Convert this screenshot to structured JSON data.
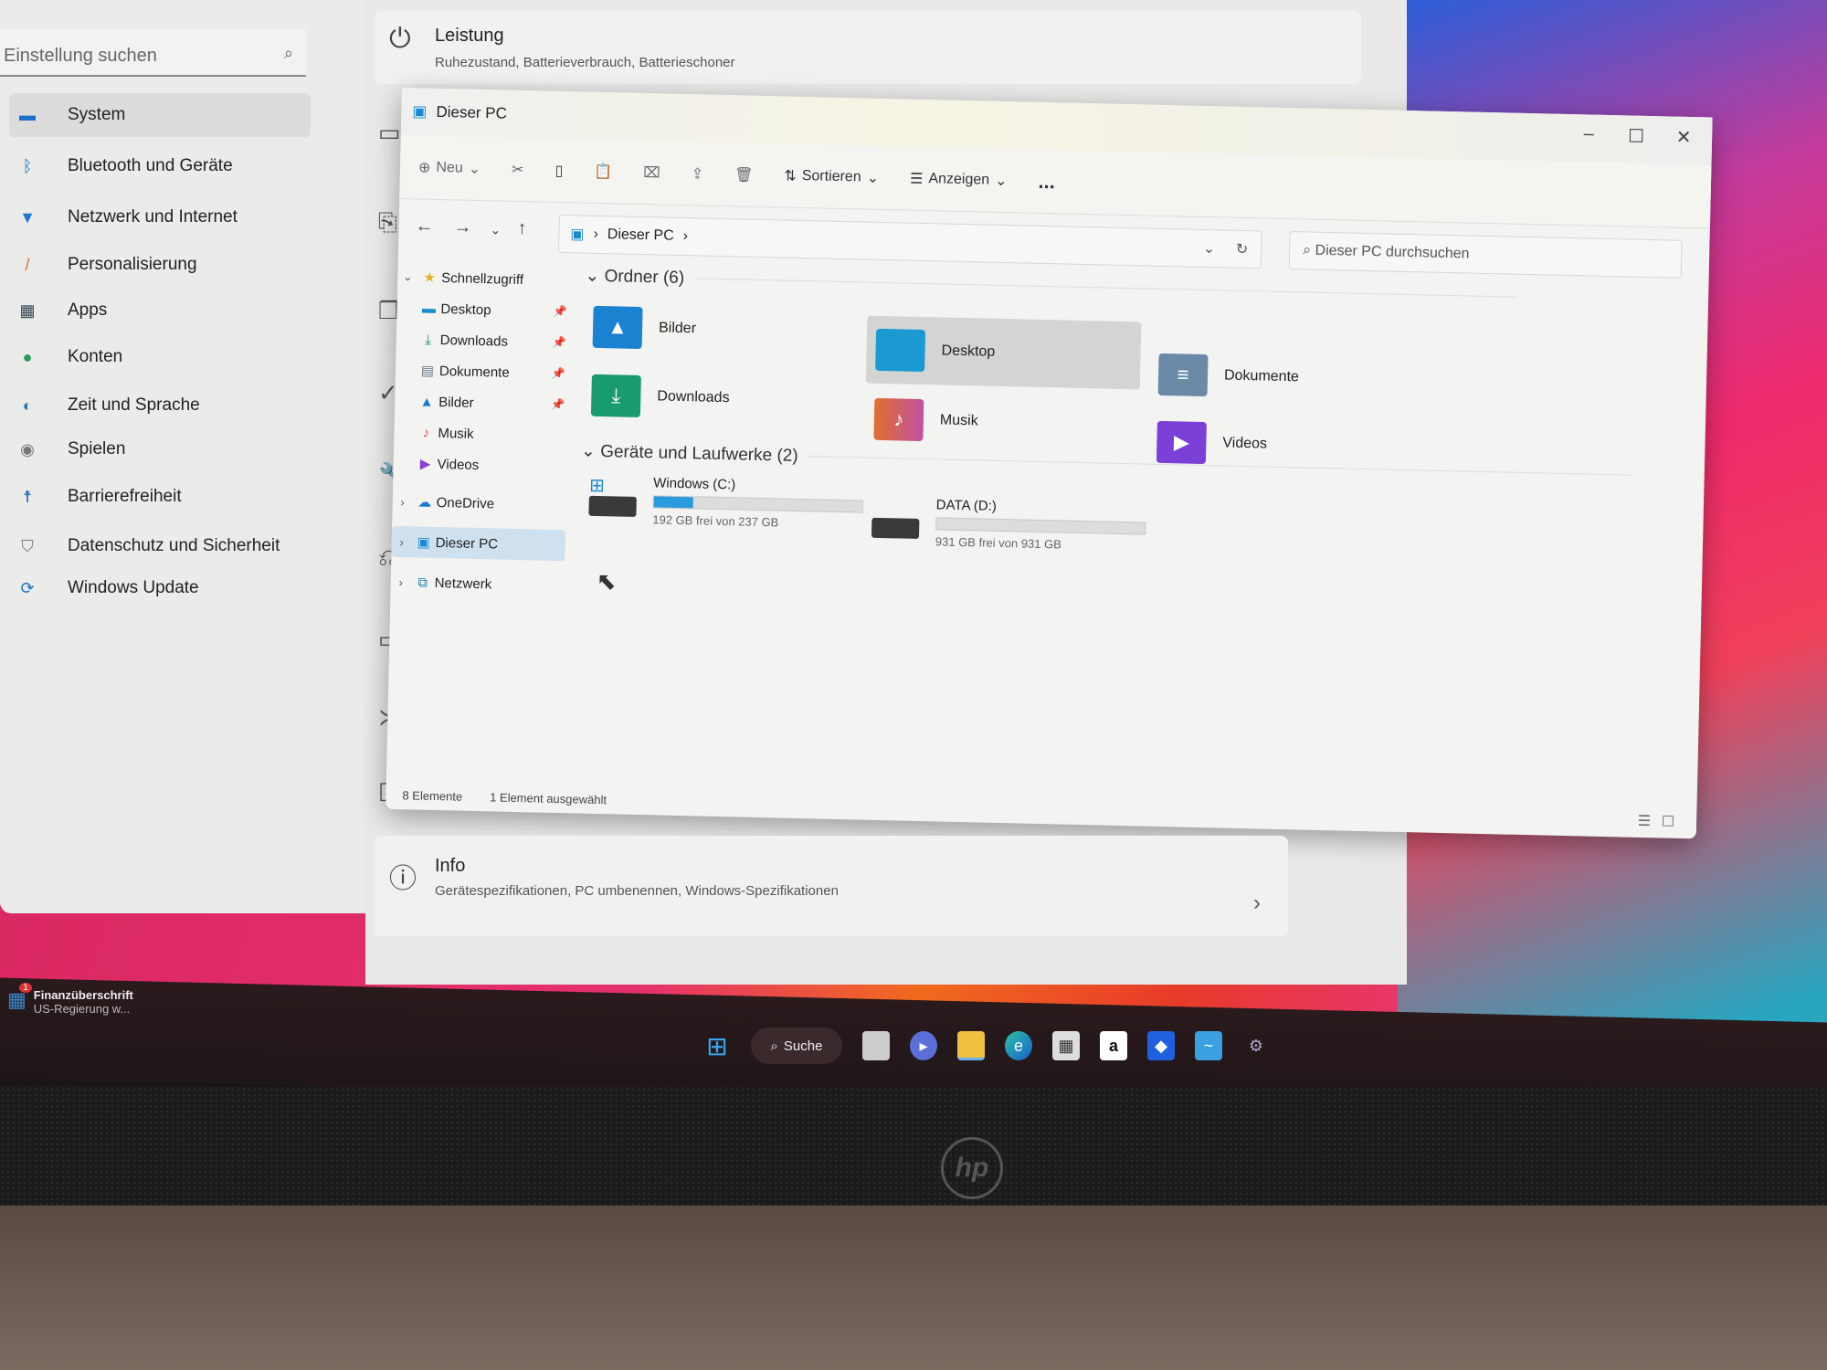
{
  "settings": {
    "search_placeholder": "Einstellung suchen",
    "nav": [
      {
        "label": "System",
        "icon": "monitor-icon",
        "selected": true
      },
      {
        "label": "Bluetooth und Geräte",
        "icon": "bluetooth-icon"
      },
      {
        "label": "Netzwerk und Internet",
        "icon": "wifi-icon"
      },
      {
        "label": "Personalisierung",
        "icon": "brush-icon"
      },
      {
        "label": "Apps",
        "icon": "apps-icon"
      },
      {
        "label": "Konten",
        "icon": "person-icon"
      },
      {
        "label": "Zeit und Sprache",
        "icon": "globe-clock-icon"
      },
      {
        "label": "Spielen",
        "icon": "gamepad-icon"
      },
      {
        "label": "Barrierefreiheit",
        "icon": "accessibility-icon"
      },
      {
        "label": "Datenschutz und Sicherheit",
        "icon": "shield-icon"
      },
      {
        "label": "Windows Update",
        "icon": "update-icon"
      }
    ],
    "power_card": {
      "title": "Leistung",
      "subtitle": "Ruhezustand, Batterieverbrauch, Batterieschoner"
    },
    "info_card": {
      "title": "Info",
      "subtitle": "Gerätespezifikationen, PC umbenennen, Windows-Spezifikationen"
    }
  },
  "explorer": {
    "title": "Dieser PC",
    "toolbar": {
      "new": "Neu",
      "sort": "Sortieren",
      "view": "Anzeigen",
      "more": "..."
    },
    "breadcrumb": "Dieser PC",
    "search_placeholder": "Dieser PC durchsuchen",
    "nav": {
      "quick_access": "Schnellzugriff",
      "quick_items": [
        "Desktop",
        "Downloads",
        "Dokumente",
        "Bilder",
        "Musik",
        "Videos"
      ],
      "onedrive": "OneDrive",
      "this_pc": "Dieser PC",
      "network": "Netzwerk"
    },
    "folders_header": "Ordner (6)",
    "folders": [
      "Bilder",
      "Desktop",
      "Dokumente",
      "Downloads",
      "Musik",
      "Videos"
    ],
    "selected_folder": "Desktop",
    "drives_header": "Geräte und Laufwerke (2)",
    "drives": [
      {
        "name": "Windows (C:)",
        "free": "192 GB frei von 237 GB",
        "used_fraction": 0.19
      },
      {
        "name": "DATA (D:)",
        "free": "931 GB frei von 931 GB",
        "used_fraction": 0.0
      }
    ],
    "status": {
      "count": "8 Elemente",
      "selected": "1 Element ausgewählt"
    }
  },
  "taskbar": {
    "search_label": "Suche",
    "notification": {
      "title": "Finanzüberschrift",
      "text": "US-Regierung w...",
      "badge": "1"
    },
    "apps": [
      "start-icon",
      "task-view-icon",
      "chat-icon",
      "file-explorer-icon",
      "edge-icon",
      "store-icon",
      "amazon-icon",
      "dropbox-icon",
      "app-icon",
      "settings-icon"
    ]
  },
  "brand": "hp"
}
